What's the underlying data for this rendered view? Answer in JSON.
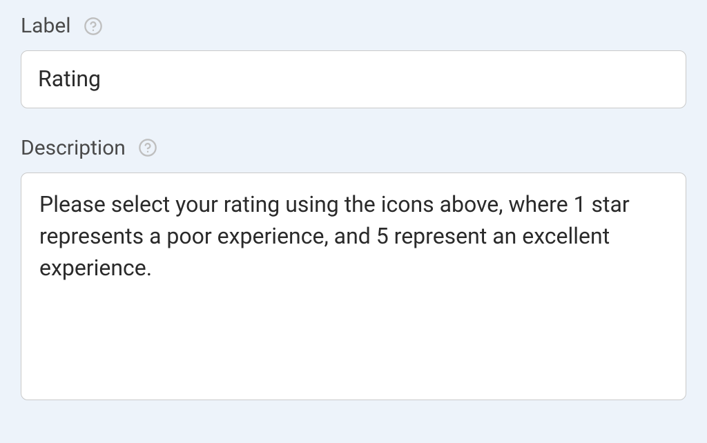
{
  "form": {
    "label_field": {
      "title": "Label",
      "value": "Rating"
    },
    "description_field": {
      "title": "Description",
      "value": "Please select your rating using the icons above, where 1 star represents a poor experience, and 5 represent an excellent experience."
    }
  }
}
